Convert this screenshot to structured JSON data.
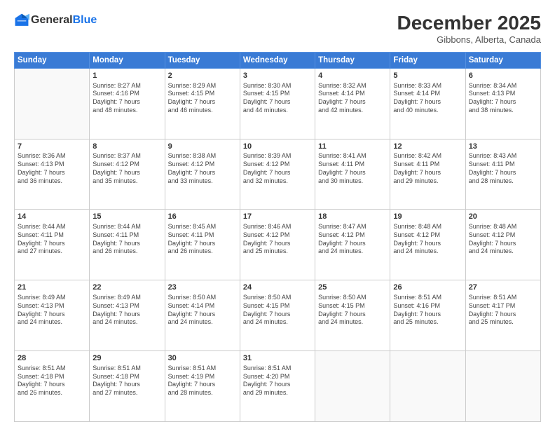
{
  "header": {
    "logo_general": "General",
    "logo_blue": "Blue",
    "month": "December 2025",
    "location": "Gibbons, Alberta, Canada"
  },
  "weekdays": [
    "Sunday",
    "Monday",
    "Tuesday",
    "Wednesday",
    "Thursday",
    "Friday",
    "Saturday"
  ],
  "weeks": [
    [
      {
        "day": "",
        "text": ""
      },
      {
        "day": "1",
        "text": "Sunrise: 8:27 AM\nSunset: 4:16 PM\nDaylight: 7 hours\nand 48 minutes."
      },
      {
        "day": "2",
        "text": "Sunrise: 8:29 AM\nSunset: 4:15 PM\nDaylight: 7 hours\nand 46 minutes."
      },
      {
        "day": "3",
        "text": "Sunrise: 8:30 AM\nSunset: 4:15 PM\nDaylight: 7 hours\nand 44 minutes."
      },
      {
        "day": "4",
        "text": "Sunrise: 8:32 AM\nSunset: 4:14 PM\nDaylight: 7 hours\nand 42 minutes."
      },
      {
        "day": "5",
        "text": "Sunrise: 8:33 AM\nSunset: 4:14 PM\nDaylight: 7 hours\nand 40 minutes."
      },
      {
        "day": "6",
        "text": "Sunrise: 8:34 AM\nSunset: 4:13 PM\nDaylight: 7 hours\nand 38 minutes."
      }
    ],
    [
      {
        "day": "7",
        "text": "Sunrise: 8:36 AM\nSunset: 4:13 PM\nDaylight: 7 hours\nand 36 minutes."
      },
      {
        "day": "8",
        "text": "Sunrise: 8:37 AM\nSunset: 4:12 PM\nDaylight: 7 hours\nand 35 minutes."
      },
      {
        "day": "9",
        "text": "Sunrise: 8:38 AM\nSunset: 4:12 PM\nDaylight: 7 hours\nand 33 minutes."
      },
      {
        "day": "10",
        "text": "Sunrise: 8:39 AM\nSunset: 4:12 PM\nDaylight: 7 hours\nand 32 minutes."
      },
      {
        "day": "11",
        "text": "Sunrise: 8:41 AM\nSunset: 4:11 PM\nDaylight: 7 hours\nand 30 minutes."
      },
      {
        "day": "12",
        "text": "Sunrise: 8:42 AM\nSunset: 4:11 PM\nDaylight: 7 hours\nand 29 minutes."
      },
      {
        "day": "13",
        "text": "Sunrise: 8:43 AM\nSunset: 4:11 PM\nDaylight: 7 hours\nand 28 minutes."
      }
    ],
    [
      {
        "day": "14",
        "text": "Sunrise: 8:44 AM\nSunset: 4:11 PM\nDaylight: 7 hours\nand 27 minutes."
      },
      {
        "day": "15",
        "text": "Sunrise: 8:44 AM\nSunset: 4:11 PM\nDaylight: 7 hours\nand 26 minutes."
      },
      {
        "day": "16",
        "text": "Sunrise: 8:45 AM\nSunset: 4:11 PM\nDaylight: 7 hours\nand 26 minutes."
      },
      {
        "day": "17",
        "text": "Sunrise: 8:46 AM\nSunset: 4:12 PM\nDaylight: 7 hours\nand 25 minutes."
      },
      {
        "day": "18",
        "text": "Sunrise: 8:47 AM\nSunset: 4:12 PM\nDaylight: 7 hours\nand 24 minutes."
      },
      {
        "day": "19",
        "text": "Sunrise: 8:48 AM\nSunset: 4:12 PM\nDaylight: 7 hours\nand 24 minutes."
      },
      {
        "day": "20",
        "text": "Sunrise: 8:48 AM\nSunset: 4:12 PM\nDaylight: 7 hours\nand 24 minutes."
      }
    ],
    [
      {
        "day": "21",
        "text": "Sunrise: 8:49 AM\nSunset: 4:13 PM\nDaylight: 7 hours\nand 24 minutes."
      },
      {
        "day": "22",
        "text": "Sunrise: 8:49 AM\nSunset: 4:13 PM\nDaylight: 7 hours\nand 24 minutes."
      },
      {
        "day": "23",
        "text": "Sunrise: 8:50 AM\nSunset: 4:14 PM\nDaylight: 7 hours\nand 24 minutes."
      },
      {
        "day": "24",
        "text": "Sunrise: 8:50 AM\nSunset: 4:15 PM\nDaylight: 7 hours\nand 24 minutes."
      },
      {
        "day": "25",
        "text": "Sunrise: 8:50 AM\nSunset: 4:15 PM\nDaylight: 7 hours\nand 24 minutes."
      },
      {
        "day": "26",
        "text": "Sunrise: 8:51 AM\nSunset: 4:16 PM\nDaylight: 7 hours\nand 25 minutes."
      },
      {
        "day": "27",
        "text": "Sunrise: 8:51 AM\nSunset: 4:17 PM\nDaylight: 7 hours\nand 25 minutes."
      }
    ],
    [
      {
        "day": "28",
        "text": "Sunrise: 8:51 AM\nSunset: 4:18 PM\nDaylight: 7 hours\nand 26 minutes."
      },
      {
        "day": "29",
        "text": "Sunrise: 8:51 AM\nSunset: 4:18 PM\nDaylight: 7 hours\nand 27 minutes."
      },
      {
        "day": "30",
        "text": "Sunrise: 8:51 AM\nSunset: 4:19 PM\nDaylight: 7 hours\nand 28 minutes."
      },
      {
        "day": "31",
        "text": "Sunrise: 8:51 AM\nSunset: 4:20 PM\nDaylight: 7 hours\nand 29 minutes."
      },
      {
        "day": "",
        "text": ""
      },
      {
        "day": "",
        "text": ""
      },
      {
        "day": "",
        "text": ""
      }
    ]
  ]
}
